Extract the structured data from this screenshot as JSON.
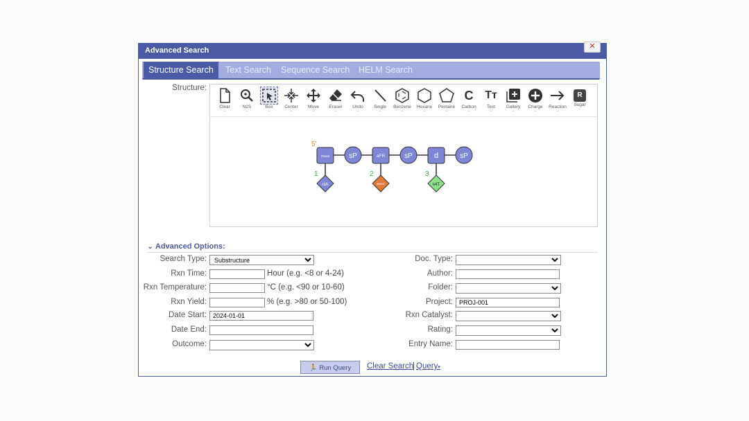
{
  "dialog": {
    "title": "Advanced Search",
    "close_glyph": "✕"
  },
  "tabs": [
    {
      "label": "Structure Search",
      "active": true
    },
    {
      "label": "Text Search"
    },
    {
      "label": "Sequence Search"
    },
    {
      "label": "HELM Search"
    }
  ],
  "structure_label": "Structure:",
  "toolbar": [
    {
      "id": "clear",
      "label": "Clear",
      "icon": "page-icon"
    },
    {
      "id": "n2s",
      "label": "N2S",
      "icon": "zoom-icon"
    },
    {
      "id": "box",
      "label": "Box",
      "icon": "box-select-icon",
      "selected": true
    },
    {
      "id": "center",
      "label": "Center",
      "icon": "center-icon"
    },
    {
      "id": "move",
      "label": "Move",
      "icon": "move-icon"
    },
    {
      "id": "eraser",
      "label": "Eraser",
      "icon": "eraser-icon"
    },
    {
      "id": "undo",
      "label": "Undo",
      "icon": "undo-icon"
    },
    {
      "id": "single",
      "label": "Single",
      "icon": "single-bond-icon"
    },
    {
      "id": "benzene",
      "label": "Benzene",
      "icon": "benzene-icon"
    },
    {
      "id": "hexane",
      "label": "Hexane",
      "icon": "hexagon-icon"
    },
    {
      "id": "pentane",
      "label": "Pentane",
      "icon": "pentagon-icon"
    },
    {
      "id": "carbon",
      "label": "Carbon",
      "icon": "carbon-icon",
      "glyph": "C"
    },
    {
      "id": "text",
      "label": "Text",
      "icon": "text-icon",
      "glyph": "Tт"
    },
    {
      "id": "gallery",
      "label": "Gallery",
      "icon": "gallery-icon"
    },
    {
      "id": "charge",
      "label": "Charge",
      "icon": "plus-circle-icon"
    },
    {
      "id": "reaction",
      "label": "Reaction",
      "icon": "arrow-right-icon"
    },
    {
      "id": "sugar",
      "label": "Sugar",
      "icon": "sugar-icon",
      "glyph": "R"
    }
  ],
  "molecule": {
    "end_label": "5'",
    "sugars": [
      {
        "label": "rNeab",
        "index": "1",
        "base": "clA",
        "base_color": "#7f86d6"
      },
      {
        "label": "aFR",
        "index": "2",
        "base": "5meC",
        "base_color": "#e07a3b"
      },
      {
        "label": "d",
        "index": "3",
        "base": "s4T",
        "base_color": "#8de08a"
      }
    ],
    "phosphates": [
      "sP",
      "sP",
      "sP"
    ],
    "colors": {
      "sugar": "#7f86d6",
      "index": "#2db24a",
      "end": "#e08a1e"
    }
  },
  "advanced_options_label": "Advanced Options:",
  "left_fields": {
    "search_type": {
      "label": "Search Type:",
      "value": "Substructure"
    },
    "rxn_time": {
      "label": "Rxn Time:",
      "value": "",
      "hint": "Hour (e.g. <8 or 4-24)"
    },
    "rxn_temperature": {
      "label": "Rxn Temperature:",
      "value": "",
      "hint": "°C (e.g. <90 or 10-60)"
    },
    "rxn_yield": {
      "label": "Rxn Yield:",
      "value": "",
      "hint": "% (e.g. >80 or 50-100)"
    },
    "date_start": {
      "label": "Date Start:",
      "value": "2024-01-01"
    },
    "date_end": {
      "label": "Date End:",
      "value": ""
    },
    "outcome": {
      "label": "Outcome:",
      "value": ""
    }
  },
  "right_fields": {
    "doc_type": {
      "label": "Doc. Type:",
      "value": ""
    },
    "author": {
      "label": "Author:",
      "value": ""
    },
    "folder": {
      "label": "Folder:",
      "value": ""
    },
    "project": {
      "label": "Project:",
      "value": "PROJ-001"
    },
    "rxn_catalyst": {
      "label": "Rxn Catalyst:",
      "value": ""
    },
    "rating": {
      "label": "Rating:",
      "value": ""
    },
    "entry_name": {
      "label": "Entry Name:",
      "value": ""
    }
  },
  "actions": {
    "run_query": "Run Query",
    "clear_search": "Clear Search",
    "separator": "|",
    "query": "Query",
    "query_caret": "▾"
  }
}
